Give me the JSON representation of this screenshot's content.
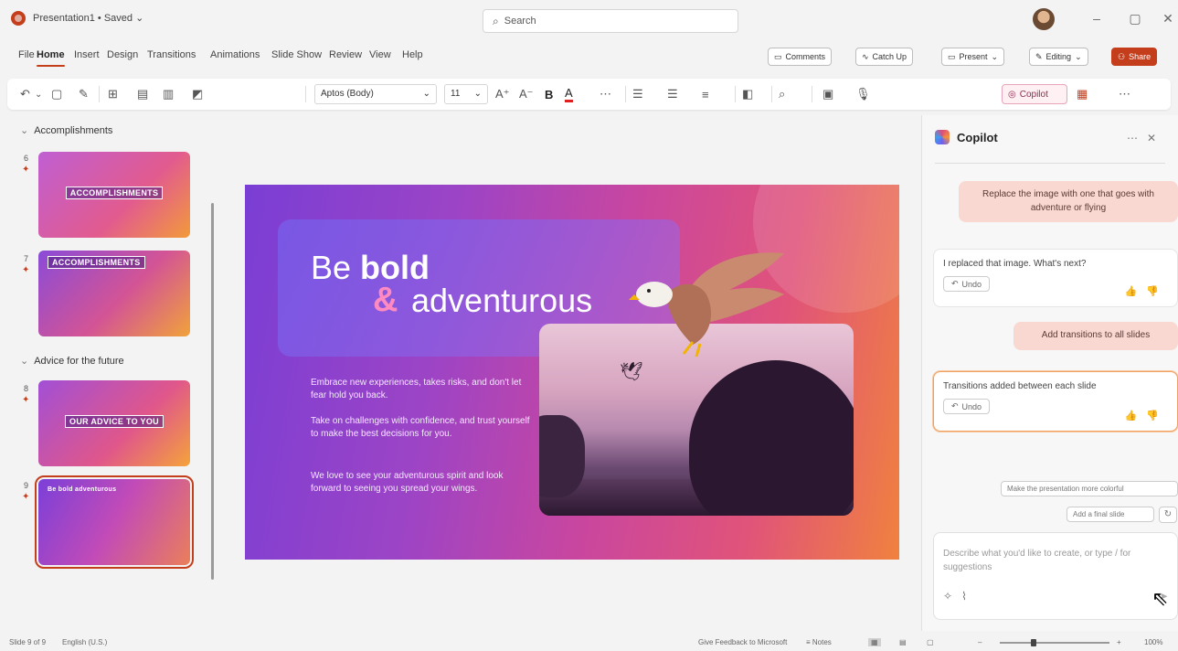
{
  "titlebar": {
    "doc_title": "Presentation1 • Saved ⌄",
    "search_placeholder": "Search",
    "minimize": "–",
    "maximize": "▢",
    "close": "✕"
  },
  "menu": {
    "items": [
      "File",
      "Home",
      "Insert",
      "Design",
      "Transitions",
      "Animations",
      "Slide Show",
      "Review",
      "View",
      "Help"
    ],
    "active": "Home",
    "comments": "Comments",
    "catch_up": "Catch Up",
    "present": "Present",
    "editing": "Editing",
    "share": "Share"
  },
  "ribbon": {
    "font": "Aptos (Body)",
    "size": "11",
    "copilot": "Copilot"
  },
  "thumbnails": {
    "sections": [
      "Accomplishments",
      "Advice for the future"
    ],
    "slides": [
      {
        "num": "6",
        "label": "ACCOMPLISHMENTS"
      },
      {
        "num": "7",
        "label": "ACCOMPLISHMENTS"
      },
      {
        "num": "8",
        "label": "OUR ADVICE TO YOU"
      },
      {
        "num": "9",
        "label": "Be bold adventurous"
      }
    ]
  },
  "slide": {
    "title_word1": "Be ",
    "title_word2": "bold",
    "amp": "&",
    "title_line2": "adventurous",
    "paragraphs": [
      "Embrace new experiences, takes risks, and don't let fear hold you back.",
      "Take on challenges with confidence, and trust yourself to make the best decisions for you.",
      "We love to see your adventurous spirit and look forward to seeing you spread your wings."
    ]
  },
  "copilot": {
    "title": "Copilot",
    "messages": [
      {
        "role": "user",
        "text": "Replace the image with one that goes with adventure or flying"
      },
      {
        "role": "ai",
        "text": "I replaced that image. What's next?",
        "undo": "Undo"
      },
      {
        "role": "user",
        "text": "Add transitions to all slides"
      },
      {
        "role": "ai",
        "text": "Transitions added between each slide",
        "undo": "Undo"
      }
    ],
    "suggestions": [
      "Make the presentation more colorful",
      "Add a final slide"
    ],
    "composer_placeholder": "Describe what you'd like to create, or type / for suggestions"
  },
  "status": {
    "slide_info": "Slide 9 of 9",
    "language": "English (U.S.)",
    "feedback": "Give Feedback to Microsoft",
    "notes": "Notes",
    "zoom": "100%"
  },
  "colors": {
    "accent": "#c43e1c",
    "slide_start": "#7a3ed4",
    "slide_end": "#f0813f"
  }
}
